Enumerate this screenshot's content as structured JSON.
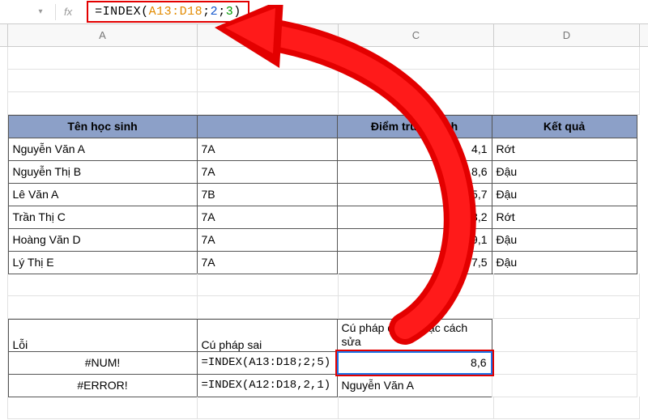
{
  "formula_bar": {
    "fx": "fx",
    "prefix": "=INDEX(",
    "range": "A13:D18",
    "sep1": ";",
    "arg1": "2",
    "sep2": ";",
    "arg2": "3",
    "suffix": ")"
  },
  "columns": {
    "A": "A",
    "B": "B",
    "C": "C",
    "D": "D"
  },
  "table1": {
    "headers": {
      "a": "Tên học sinh",
      "b": "",
      "c": "Điểm trung bình",
      "d": "Kết quả"
    },
    "rows": [
      {
        "a": "Nguyễn Văn A",
        "b": "7A",
        "c": "4,1",
        "d": "Rớt"
      },
      {
        "a": "Nguyễn Thị B",
        "b": "7A",
        "c": "8,6",
        "d": "Đậu"
      },
      {
        "a": "Lê Văn A",
        "b": "7B",
        "c": "5,7",
        "d": "Đậu"
      },
      {
        "a": "Trần Thị C",
        "b": "7A",
        "c": "3,2",
        "d": "Rớt"
      },
      {
        "a": "Hoàng Văn D",
        "b": "7A",
        "c": "9,1",
        "d": "Đậu"
      },
      {
        "a": "Lý Thị E",
        "b": "7A",
        "c": "7,5",
        "d": "Đậu"
      }
    ]
  },
  "table2": {
    "headers": {
      "a": "Lỗi",
      "b": "Cú pháp sai",
      "c": "Cú pháp đúng hoặc cách sửa"
    },
    "rows": [
      {
        "a": "#NUM!",
        "b": "=INDEX(A13:D18;2;5)",
        "c": "8,6"
      },
      {
        "a": "#ERROR!",
        "b": "=INDEX(A12:D18,2,1)",
        "c": "Nguyễn Văn A"
      }
    ]
  }
}
